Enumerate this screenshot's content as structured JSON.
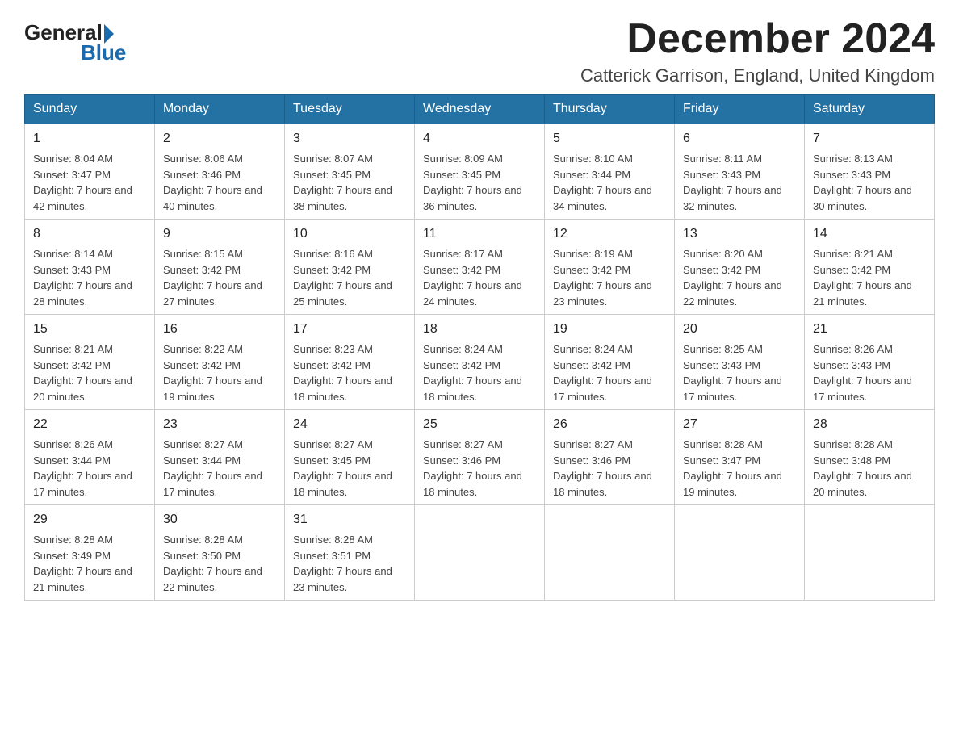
{
  "logo": {
    "general": "General",
    "blue": "Blue"
  },
  "title": "December 2024",
  "location": "Catterick Garrison, England, United Kingdom",
  "headers": [
    "Sunday",
    "Monday",
    "Tuesday",
    "Wednesday",
    "Thursday",
    "Friday",
    "Saturday"
  ],
  "weeks": [
    [
      {
        "day": "1",
        "sunrise": "8:04 AM",
        "sunset": "3:47 PM",
        "daylight": "7 hours and 42 minutes."
      },
      {
        "day": "2",
        "sunrise": "8:06 AM",
        "sunset": "3:46 PM",
        "daylight": "7 hours and 40 minutes."
      },
      {
        "day": "3",
        "sunrise": "8:07 AM",
        "sunset": "3:45 PM",
        "daylight": "7 hours and 38 minutes."
      },
      {
        "day": "4",
        "sunrise": "8:09 AM",
        "sunset": "3:45 PM",
        "daylight": "7 hours and 36 minutes."
      },
      {
        "day": "5",
        "sunrise": "8:10 AM",
        "sunset": "3:44 PM",
        "daylight": "7 hours and 34 minutes."
      },
      {
        "day": "6",
        "sunrise": "8:11 AM",
        "sunset": "3:43 PM",
        "daylight": "7 hours and 32 minutes."
      },
      {
        "day": "7",
        "sunrise": "8:13 AM",
        "sunset": "3:43 PM",
        "daylight": "7 hours and 30 minutes."
      }
    ],
    [
      {
        "day": "8",
        "sunrise": "8:14 AM",
        "sunset": "3:43 PM",
        "daylight": "7 hours and 28 minutes."
      },
      {
        "day": "9",
        "sunrise": "8:15 AM",
        "sunset": "3:42 PM",
        "daylight": "7 hours and 27 minutes."
      },
      {
        "day": "10",
        "sunrise": "8:16 AM",
        "sunset": "3:42 PM",
        "daylight": "7 hours and 25 minutes."
      },
      {
        "day": "11",
        "sunrise": "8:17 AM",
        "sunset": "3:42 PM",
        "daylight": "7 hours and 24 minutes."
      },
      {
        "day": "12",
        "sunrise": "8:19 AM",
        "sunset": "3:42 PM",
        "daylight": "7 hours and 23 minutes."
      },
      {
        "day": "13",
        "sunrise": "8:20 AM",
        "sunset": "3:42 PM",
        "daylight": "7 hours and 22 minutes."
      },
      {
        "day": "14",
        "sunrise": "8:21 AM",
        "sunset": "3:42 PM",
        "daylight": "7 hours and 21 minutes."
      }
    ],
    [
      {
        "day": "15",
        "sunrise": "8:21 AM",
        "sunset": "3:42 PM",
        "daylight": "7 hours and 20 minutes."
      },
      {
        "day": "16",
        "sunrise": "8:22 AM",
        "sunset": "3:42 PM",
        "daylight": "7 hours and 19 minutes."
      },
      {
        "day": "17",
        "sunrise": "8:23 AM",
        "sunset": "3:42 PM",
        "daylight": "7 hours and 18 minutes."
      },
      {
        "day": "18",
        "sunrise": "8:24 AM",
        "sunset": "3:42 PM",
        "daylight": "7 hours and 18 minutes."
      },
      {
        "day": "19",
        "sunrise": "8:24 AM",
        "sunset": "3:42 PM",
        "daylight": "7 hours and 17 minutes."
      },
      {
        "day": "20",
        "sunrise": "8:25 AM",
        "sunset": "3:43 PM",
        "daylight": "7 hours and 17 minutes."
      },
      {
        "day": "21",
        "sunrise": "8:26 AM",
        "sunset": "3:43 PM",
        "daylight": "7 hours and 17 minutes."
      }
    ],
    [
      {
        "day": "22",
        "sunrise": "8:26 AM",
        "sunset": "3:44 PM",
        "daylight": "7 hours and 17 minutes."
      },
      {
        "day": "23",
        "sunrise": "8:27 AM",
        "sunset": "3:44 PM",
        "daylight": "7 hours and 17 minutes."
      },
      {
        "day": "24",
        "sunrise": "8:27 AM",
        "sunset": "3:45 PM",
        "daylight": "7 hours and 18 minutes."
      },
      {
        "day": "25",
        "sunrise": "8:27 AM",
        "sunset": "3:46 PM",
        "daylight": "7 hours and 18 minutes."
      },
      {
        "day": "26",
        "sunrise": "8:27 AM",
        "sunset": "3:46 PM",
        "daylight": "7 hours and 18 minutes."
      },
      {
        "day": "27",
        "sunrise": "8:28 AM",
        "sunset": "3:47 PM",
        "daylight": "7 hours and 19 minutes."
      },
      {
        "day": "28",
        "sunrise": "8:28 AM",
        "sunset": "3:48 PM",
        "daylight": "7 hours and 20 minutes."
      }
    ],
    [
      {
        "day": "29",
        "sunrise": "8:28 AM",
        "sunset": "3:49 PM",
        "daylight": "7 hours and 21 minutes."
      },
      {
        "day": "30",
        "sunrise": "8:28 AM",
        "sunset": "3:50 PM",
        "daylight": "7 hours and 22 minutes."
      },
      {
        "day": "31",
        "sunrise": "8:28 AM",
        "sunset": "3:51 PM",
        "daylight": "7 hours and 23 minutes."
      },
      null,
      null,
      null,
      null
    ]
  ]
}
